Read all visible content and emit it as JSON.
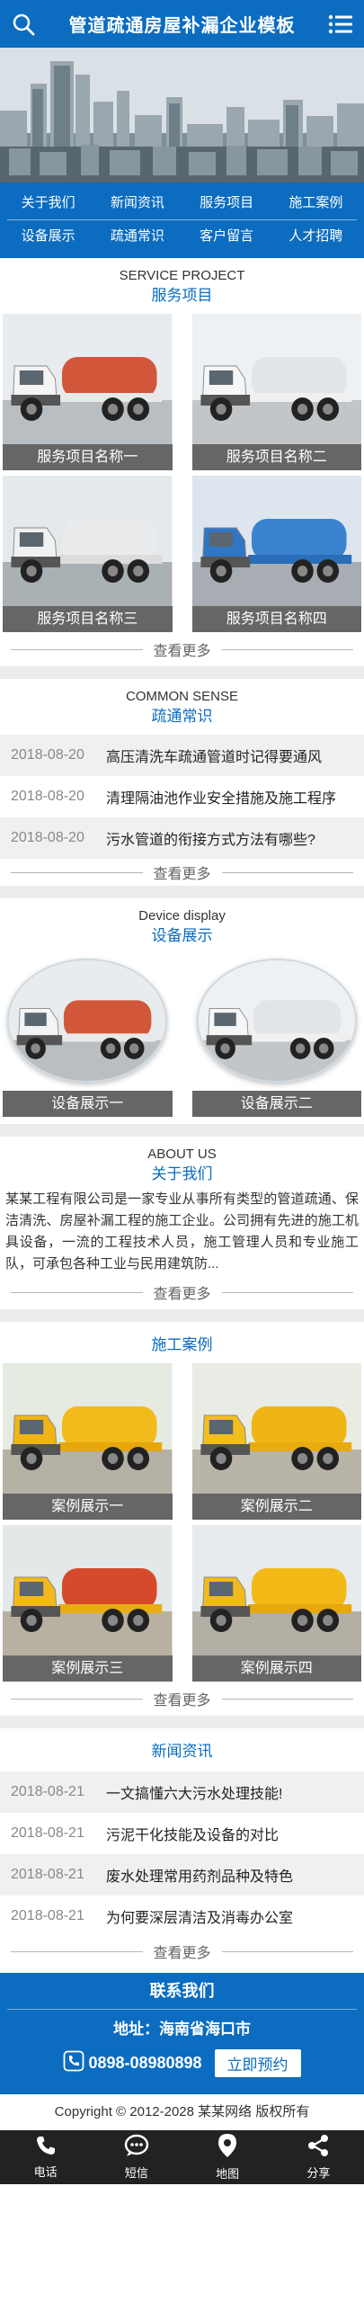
{
  "header": {
    "title": "管道疏通房屋补漏企业模板",
    "search_icon": "search-icon",
    "menu_icon": "menu-icon"
  },
  "nav": [
    {
      "label": "关于我们"
    },
    {
      "label": "新闻资讯"
    },
    {
      "label": "服务项目"
    },
    {
      "label": "施工案例"
    },
    {
      "label": "设备展示"
    },
    {
      "label": "疏通常识"
    },
    {
      "label": "客户留言"
    },
    {
      "label": "人才招聘"
    }
  ],
  "service": {
    "en": "SERVICE PROJECT",
    "cn": "服务项目",
    "items": [
      {
        "label": "服务项目名称一",
        "truck_color": "#c9cbce",
        "cab_color": "#f2f2f2",
        "tank_color": "#d2573a"
      },
      {
        "label": "服务项目名称二",
        "truck_color": "#e9ecee",
        "cab_color": "#f4f4f4",
        "tank_color": "#dfe3e6"
      },
      {
        "label": "服务项目名称三",
        "truck_color": "#d8dde0",
        "cab_color": "#f0f0f0",
        "tank_color": "#e8eaec"
      },
      {
        "label": "服务项目名称四",
        "truck_color": "#3e7fc7",
        "cab_color": "#2b6fbd",
        "tank_color": "#2f77c4"
      }
    ],
    "more": "查看更多"
  },
  "sense": {
    "en": "COMMON SENSE",
    "cn": "疏通常识",
    "items": [
      {
        "date": "2018-08-20",
        "title": "高压清洗车疏通管道时记得要通风"
      },
      {
        "date": "2018-08-20",
        "title": "清理隔油池作业安全措施及施工程序"
      },
      {
        "date": "2018-08-20",
        "title": "污水管道的衔接方式方法有哪些?"
      }
    ],
    "more": "查看更多"
  },
  "device": {
    "en": "Device display",
    "cn": "设备展示",
    "items": [
      {
        "label": "设备展示一"
      },
      {
        "label": "设备展示二"
      }
    ]
  },
  "about": {
    "en": "ABOUT US",
    "cn": "关于我们",
    "text": "某某工程有限公司是一家专业从事所有类型的管道疏通、保洁清洗、房屋补漏工程的施工企业。公司拥有先进的施工机具设备，一流的工程技术人员，施工管理人员和专业施工队，可承包各种工业与民用建筑防...",
    "more": "查看更多"
  },
  "cases": {
    "cn": "施工案例",
    "items": [
      {
        "label": "案例展示一"
      },
      {
        "label": "案例展示二"
      },
      {
        "label": "案例展示三"
      },
      {
        "label": "案例展示四"
      }
    ],
    "more": "查看更多"
  },
  "news": {
    "cn": "新闻资讯",
    "items": [
      {
        "date": "2018-08-21",
        "title": "一文搞懂六大污水处理技能!"
      },
      {
        "date": "2018-08-21",
        "title": "污泥干化技能及设备的对比"
      },
      {
        "date": "2018-08-21",
        "title": "废水处理常用药剂品种及特色"
      },
      {
        "date": "2018-08-21",
        "title": "为何要深层清洁及消毒办公室"
      }
    ],
    "more": "查看更多"
  },
  "contact": {
    "title": "联系我们",
    "address": "地址：海南省海口市",
    "phone": "0898-08980898",
    "book": "立即预约"
  },
  "copyright": "Copyright © 2012-2028 某某网络 版权所有",
  "bottom_bar": [
    {
      "label": "电话",
      "icon": "phone-icon"
    },
    {
      "label": "短信",
      "icon": "message-icon"
    },
    {
      "label": "地图",
      "icon": "map-pin-icon"
    },
    {
      "label": "分享",
      "icon": "share-icon"
    }
  ],
  "colors": {
    "brand": "#0b6cc0",
    "dark": "#222222",
    "label_bg": "#666666"
  }
}
